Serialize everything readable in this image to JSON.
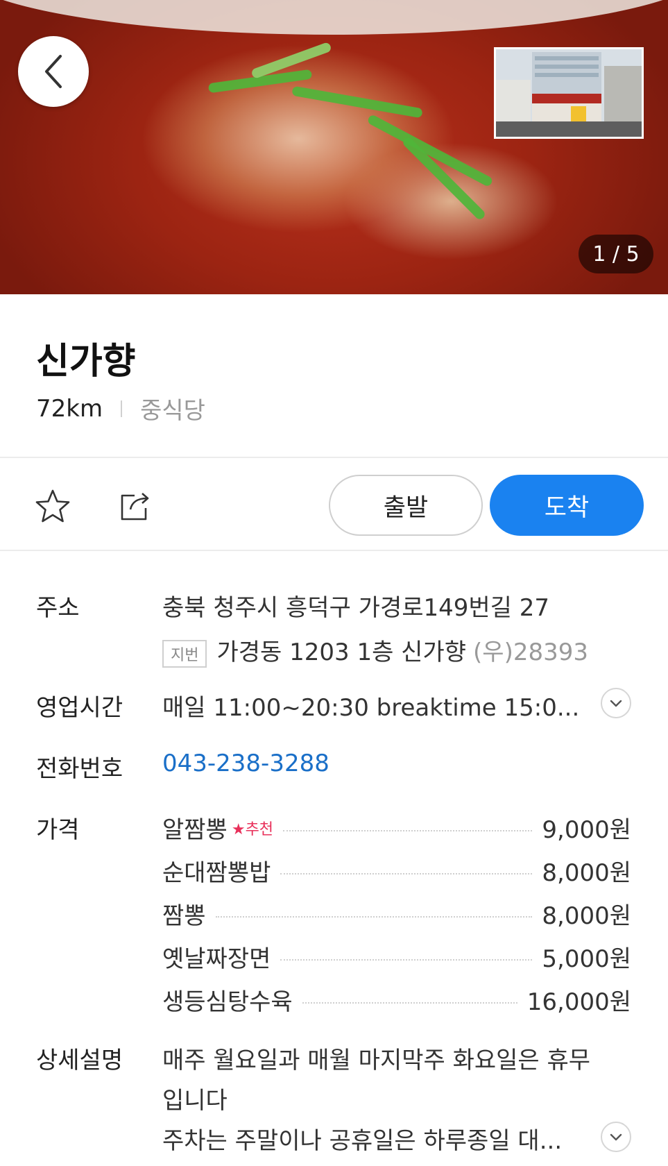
{
  "hero": {
    "counter": "1 / 5",
    "back_icon": "chevron-left-icon",
    "thumbnail_icon": "storefront-photo"
  },
  "place": {
    "name": "신가향",
    "distance": "72km",
    "category": "중식당"
  },
  "actions": {
    "favorite_icon": "star-icon",
    "share_icon": "share-icon",
    "depart_label": "출발",
    "arrive_label": "도착",
    "accent_color": "#1a82f0"
  },
  "info": {
    "address": {
      "label": "주소",
      "road": "충북 청주시 흥덕구 가경로149번길 27",
      "jibun_tag": "지번",
      "jibun": "가경동 1203 1층 신가향",
      "zip": "(우)28393"
    },
    "hours": {
      "label": "영업시간",
      "value": "매일 11:00~20:30 breaktime 15:0..."
    },
    "phone": {
      "label": "전화번호",
      "value": "043-238-3288"
    },
    "price": {
      "label": "가격",
      "items": [
        {
          "name": "알짬뽕",
          "badge": "★추천",
          "price": "9,000원"
        },
        {
          "name": "순대짬뽕밥",
          "price": "8,000원"
        },
        {
          "name": "짬뽕",
          "price": "8,000원"
        },
        {
          "name": "옛날짜장면",
          "price": "5,000원"
        },
        {
          "name": "생등심탕수육",
          "price": "16,000원"
        }
      ]
    },
    "description": {
      "label": "상세설명",
      "line1": "매주 월요일과 매월 마지막주 화요일은 휴무",
      "line2": "입니다",
      "line3": "주차는 주말이나 공휴일은 하루종일 대..."
    }
  }
}
